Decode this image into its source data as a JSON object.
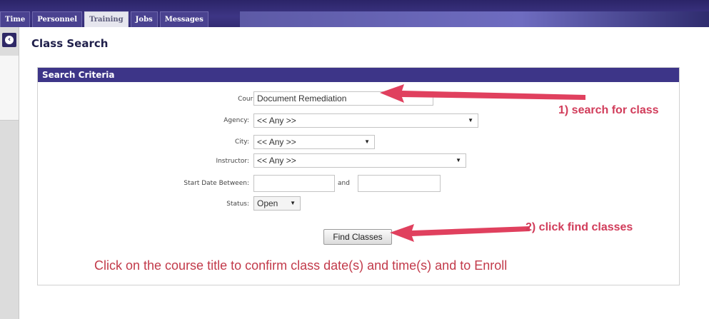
{
  "nav": {
    "tabs": [
      {
        "label": "Time",
        "active": false
      },
      {
        "label": "Personnel",
        "active": false
      },
      {
        "label": "Training",
        "active": true
      },
      {
        "label": "Jobs",
        "active": false
      },
      {
        "label": "Messages",
        "active": false
      }
    ]
  },
  "page": {
    "title": "Class Search"
  },
  "search": {
    "header": "Search Criteria",
    "course_name": {
      "label": "Course Name:",
      "value": "Document Remediation"
    },
    "agency": {
      "label": "Agency:",
      "value": "<< Any >>"
    },
    "city": {
      "label": "City:",
      "value": "<< Any >>"
    },
    "instructor": {
      "label": "Instructor:",
      "value": "<< Any >>"
    },
    "start_date": {
      "label": "Start Date Between:",
      "and_label": "and",
      "from": "",
      "to": ""
    },
    "status": {
      "label": "Status:",
      "value": "Open"
    },
    "find_button": "Find Classes"
  },
  "annotations": {
    "step1": "1) search for class",
    "step2": "2) click find classes",
    "instruction": "Click on the course title to confirm class date(s) and time(s) and to Enroll"
  },
  "colors": {
    "nav_bg": "#332c74",
    "panel_header": "#3d3588",
    "annotation": "#d13c5a"
  },
  "icons": {
    "rail_button": "collapse-arrow-icon",
    "dropdown": "dropdown-arrow-icon"
  }
}
